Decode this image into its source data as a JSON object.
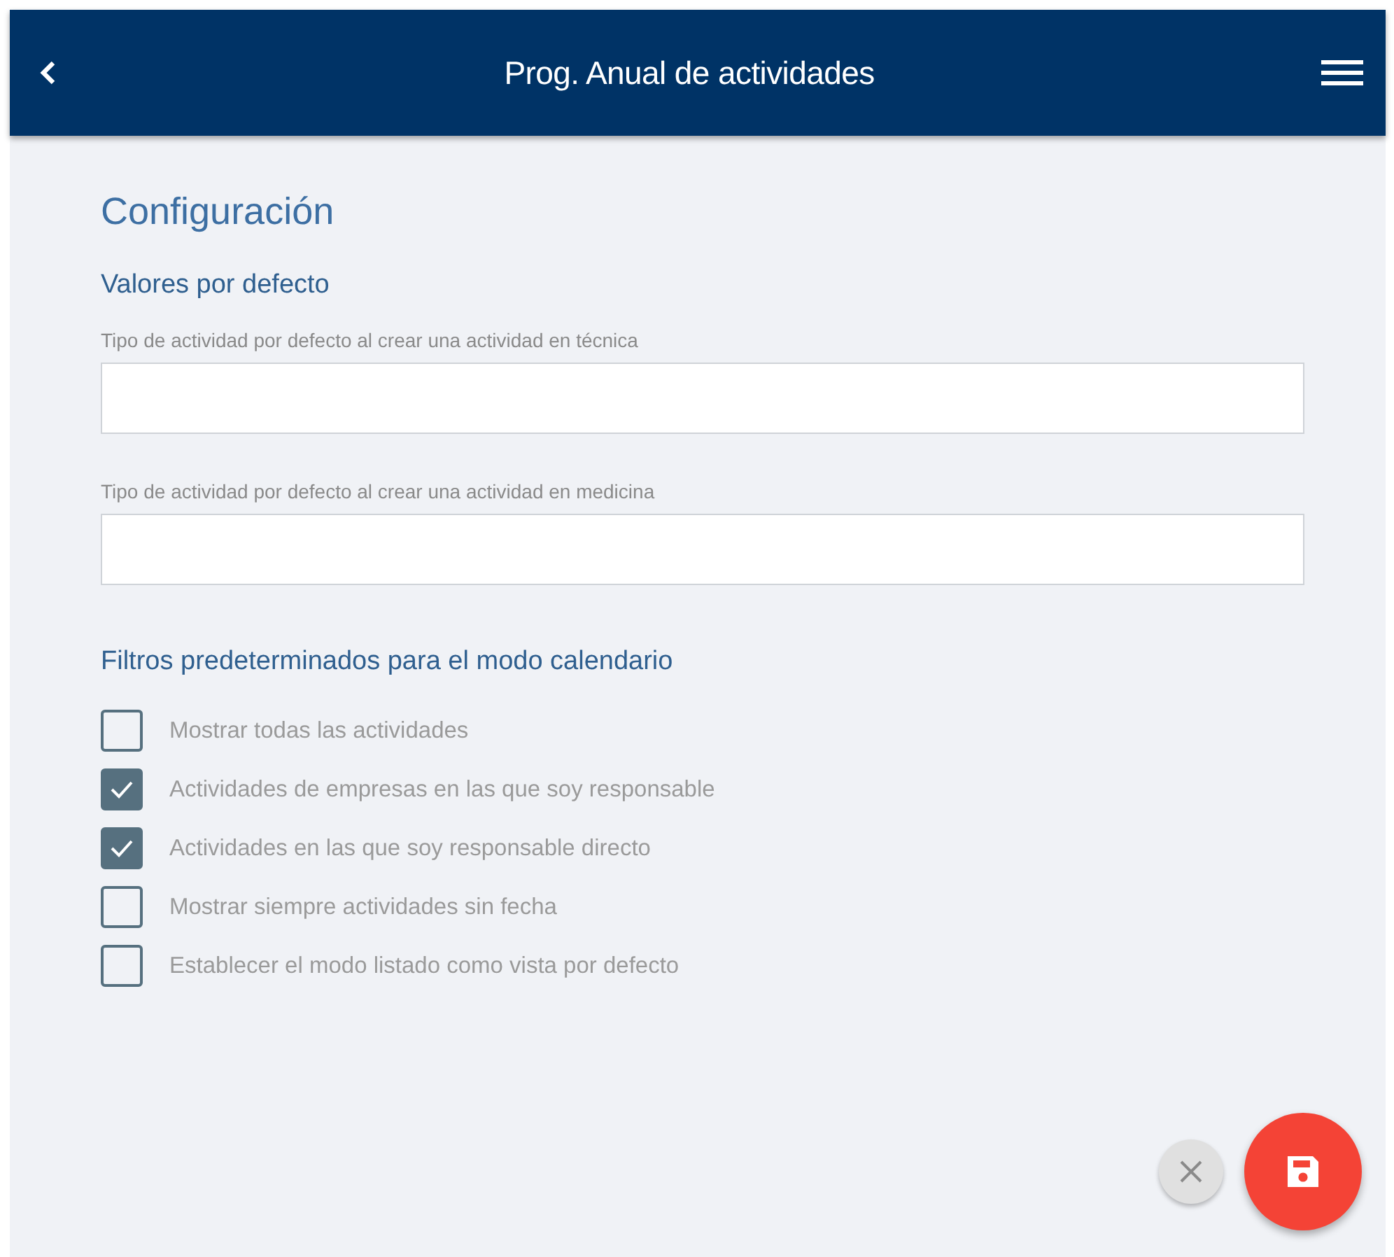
{
  "header": {
    "title": "Prog. Anual de actividades"
  },
  "page_title": "Configuración",
  "defaults_section": {
    "title": "Valores por defecto",
    "fields": [
      {
        "label": "Tipo de actividad por defecto al crear una actividad en técnica"
      },
      {
        "label": "Tipo de actividad por defecto al crear una actividad en medicina"
      }
    ]
  },
  "filters_section": {
    "title": "Filtros predeterminados para el modo calendario",
    "options": [
      {
        "label": "Mostrar todas las actividades",
        "checked": false
      },
      {
        "label": "Actividades de empresas en las que soy responsable",
        "checked": true
      },
      {
        "label": "Actividades en las que soy responsable directo",
        "checked": true
      },
      {
        "label": "Mostrar siempre actividades sin fecha",
        "checked": false
      },
      {
        "label": "Establecer el modo listado como vista por defecto",
        "checked": false
      }
    ]
  }
}
